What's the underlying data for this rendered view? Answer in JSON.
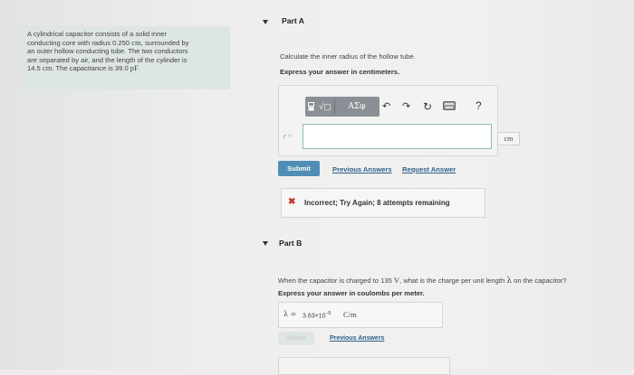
{
  "problem": {
    "line1": "A cylindrical capacitor consists of a solid inner",
    "line2_a": "conducting core with radius 0.250 ",
    "line2_unit": "cm",
    "line2_b": ", surrounded by",
    "line3": "an outer hollow conducting tube. The two conductors",
    "line4": "are separated by air, and the length of the cylinder is",
    "line5_a": "14.5 ",
    "line5_unit": "cm",
    "line5_b": ". The capacitance is 39.0 ",
    "line5_unit2": "pF",
    "line5_c": "."
  },
  "part_a": {
    "title": "Part A",
    "question": "Calculate the inner radius of the hollow tube.",
    "instruction": "Express your answer in centimeters.",
    "toolbar": {
      "template_icon": "template-icon",
      "sqrt_icon": "√▢",
      "greek_label": "ΑΣφ",
      "undo_icon": "↶",
      "redo_icon": "↷",
      "reset_icon": "↻",
      "keyboard_icon": "▭",
      "help_icon": "?"
    },
    "input_label": "r =",
    "input_value": "",
    "unit": "cm",
    "submit_label": "Submit",
    "previous_answers_label": "Previous Answers",
    "request_answer_label": "Request Answer",
    "feedback_icon": "✖",
    "feedback_text": "Incorrect; Try Again; 8 attempts remaining"
  },
  "part_b": {
    "title": "Part B",
    "question_a": "When the capacitor is charged to 135 ",
    "question_unit": "V",
    "question_b": ", what is the charge per unit length ",
    "question_sym": "λ",
    "question_c": " on the capacitor?",
    "instruction": "Express your answer in coulombs per meter.",
    "answer_label": "λ =",
    "answer_value": "3.63×10",
    "answer_exp": "−8",
    "answer_unit": "C/m",
    "submit_label": "Submit",
    "previous_answers_label": "Previous Answers"
  }
}
